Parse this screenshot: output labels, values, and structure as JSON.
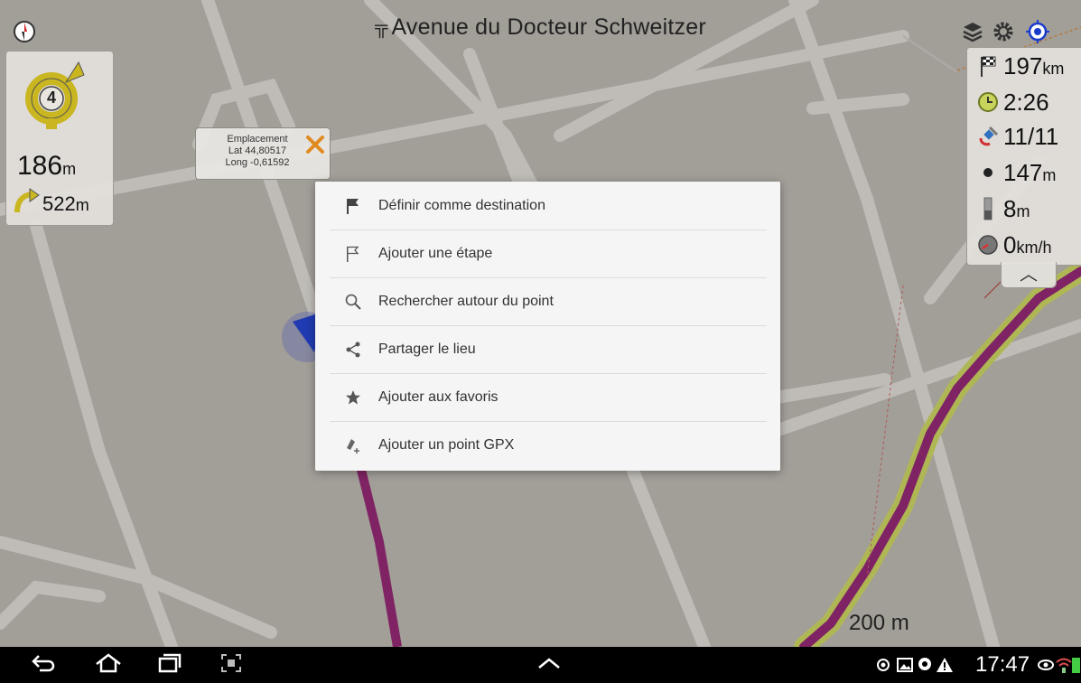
{
  "header": {
    "street_name": "Avenue du Docteur Schweitzer",
    "street_symbol": "╦"
  },
  "turn": {
    "exit_number": "4",
    "distance": "186",
    "distance_unit": "m",
    "next_distance": "522",
    "next_unit": "m"
  },
  "info": {
    "distance": {
      "value": "197",
      "unit": "km",
      "icon": "checkered-flag-icon"
    },
    "time": {
      "value": "2:26",
      "icon": "clock-icon"
    },
    "satellites": {
      "value": "11/11",
      "icon": "satellite-icon"
    },
    "altitude": {
      "value": "147",
      "unit": "m",
      "icon": "altitude-dot-icon"
    },
    "accuracy": {
      "value": "8",
      "unit": "m",
      "icon": "gauge-bar-icon"
    },
    "speed": {
      "value": "0",
      "unit": "km/h",
      "icon": "speedometer-icon"
    }
  },
  "location_bubble": {
    "title": "Emplacement",
    "lat": "Lat 44,80517",
    "long": "Long -0,61592"
  },
  "context_menu": {
    "items": [
      {
        "label": "Définir comme destination",
        "icon": "flag-filled-icon"
      },
      {
        "label": "Ajouter une étape",
        "icon": "flag-outline-icon"
      },
      {
        "label": "Rechercher autour du point",
        "icon": "search-icon"
      },
      {
        "label": "Partager le lieu",
        "icon": "share-icon"
      },
      {
        "label": "Ajouter aux favoris",
        "icon": "star-icon"
      },
      {
        "label": "Ajouter un point GPX",
        "icon": "gpx-point-icon"
      }
    ]
  },
  "map": {
    "scale_label": "200 m"
  },
  "status_bar": {
    "time": "17:47"
  },
  "colors": {
    "route": "#8e1f6e",
    "route_halo": "#c9d45c",
    "map_bg": "#b9b5ae",
    "road": "#d9d6d0"
  }
}
